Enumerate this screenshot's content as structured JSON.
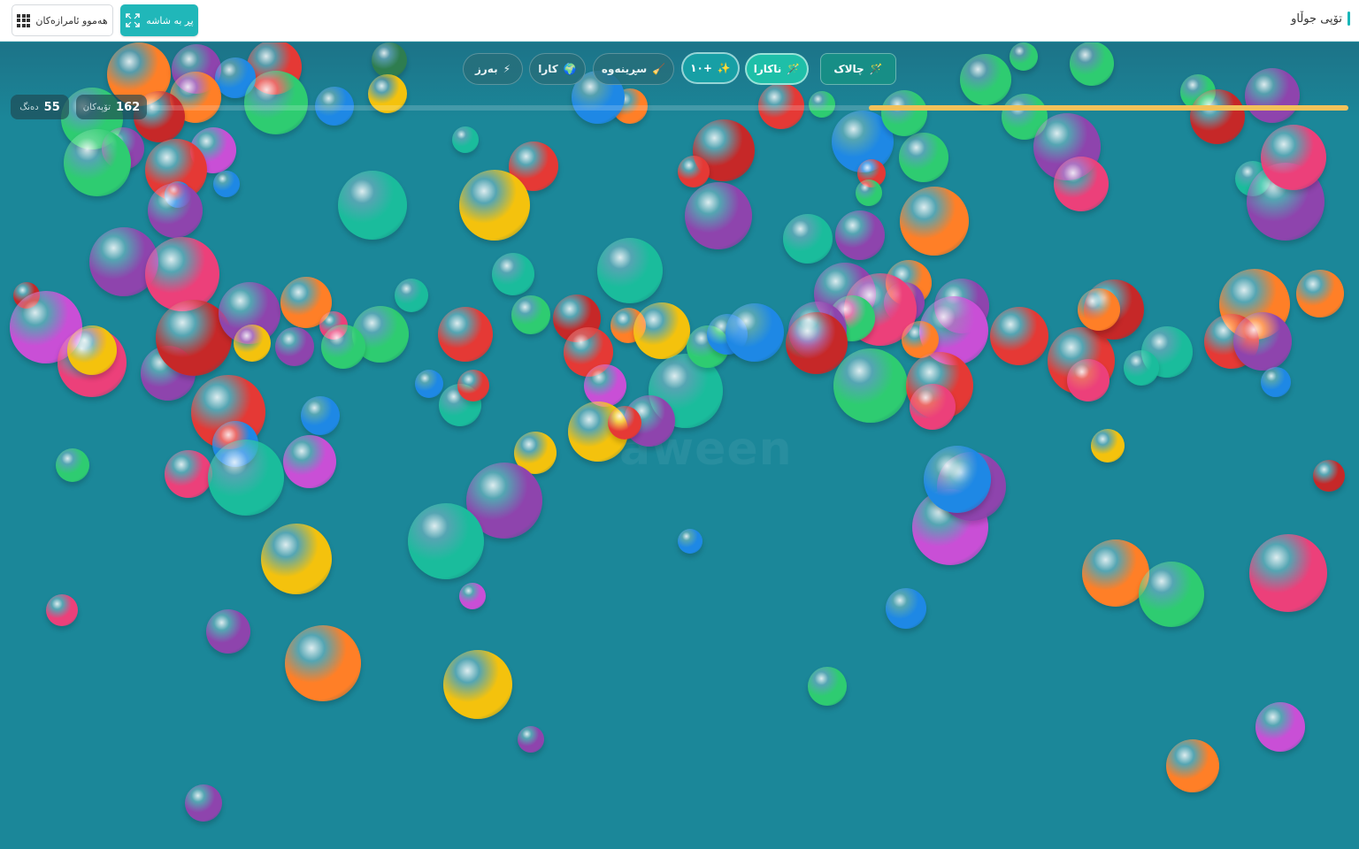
{
  "header": {
    "title": "تۆپی جوڵاو",
    "fullscreen_label": "پڕ بە شاشە",
    "all_tools_label": "هەموو ئامرازەکان"
  },
  "toolbar": {
    "items": [
      {
        "label": "چالاک",
        "icon": "magic-wand-icon",
        "state": "active"
      },
      {
        "label": "ناکارا",
        "icon": "magic-wand-icon",
        "state": "active"
      },
      {
        "label": "+۱۰",
        "icon": "sparkle-icon",
        "state": "active"
      },
      {
        "label": "سڕینەوە",
        "icon": "broom-icon",
        "state": "normal"
      },
      {
        "label": "کارا",
        "icon": "globe-icon",
        "state": "normal"
      },
      {
        "label": "بەرز",
        "icon": "lightning-icon",
        "state": "normal"
      }
    ]
  },
  "stats": {
    "balls_count": "162",
    "balls_label": "تۆپەکان",
    "sound_count": "55",
    "sound_label": "دەنگ"
  },
  "progress": {
    "fraction": 0.4
  },
  "watermark": "aween",
  "colors": {
    "background": "#1b8799",
    "accent": "#20b7b9",
    "progress": "#f2c15a"
  },
  "balls": {
    "count_drawn": "many",
    "palette": [
      "#e53935",
      "#f4c20d",
      "#2ecc71",
      "#1e88e5",
      "#8e44ad",
      "#ec407a",
      "#ff7f27",
      "#1abc9c",
      "#c94fd6",
      "#2e7d4f",
      "#c62828"
    ]
  }
}
